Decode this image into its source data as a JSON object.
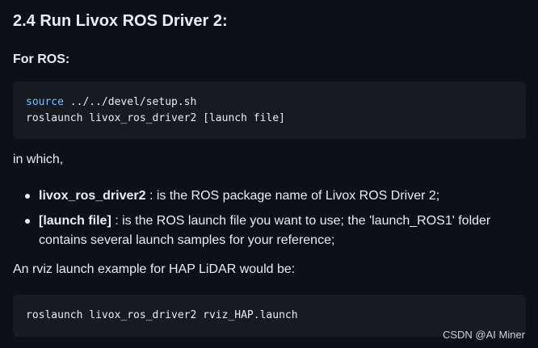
{
  "heading": "2.4 Run Livox ROS Driver 2:",
  "subheading": "For ROS:",
  "code_block_1": {
    "line1_keyword": "source",
    "line1_rest": " ../../devel/setup.sh",
    "line2": "roslaunch livox_ros_driver2 [launch file]"
  },
  "intro_text": "in which,",
  "list": [
    {
      "term": "livox_ros_driver2",
      "description": " : is the ROS package name of Livox ROS Driver 2;"
    },
    {
      "term": "[launch file]",
      "description": " : is the ROS launch file you want to use; the 'launch_ROS1' folder contains several launch samples for your reference;"
    }
  ],
  "example_text": "An rviz launch example for HAP LiDAR would be:",
  "code_block_2": {
    "line1": "roslaunch livox_ros_driver2 rviz_HAP.launch"
  },
  "watermark": "CSDN @AI Miner",
  "colors": {
    "background": "#0d1117",
    "code_background": "#161b22",
    "text": "#e6edf3",
    "keyword": "#79c0ff"
  }
}
